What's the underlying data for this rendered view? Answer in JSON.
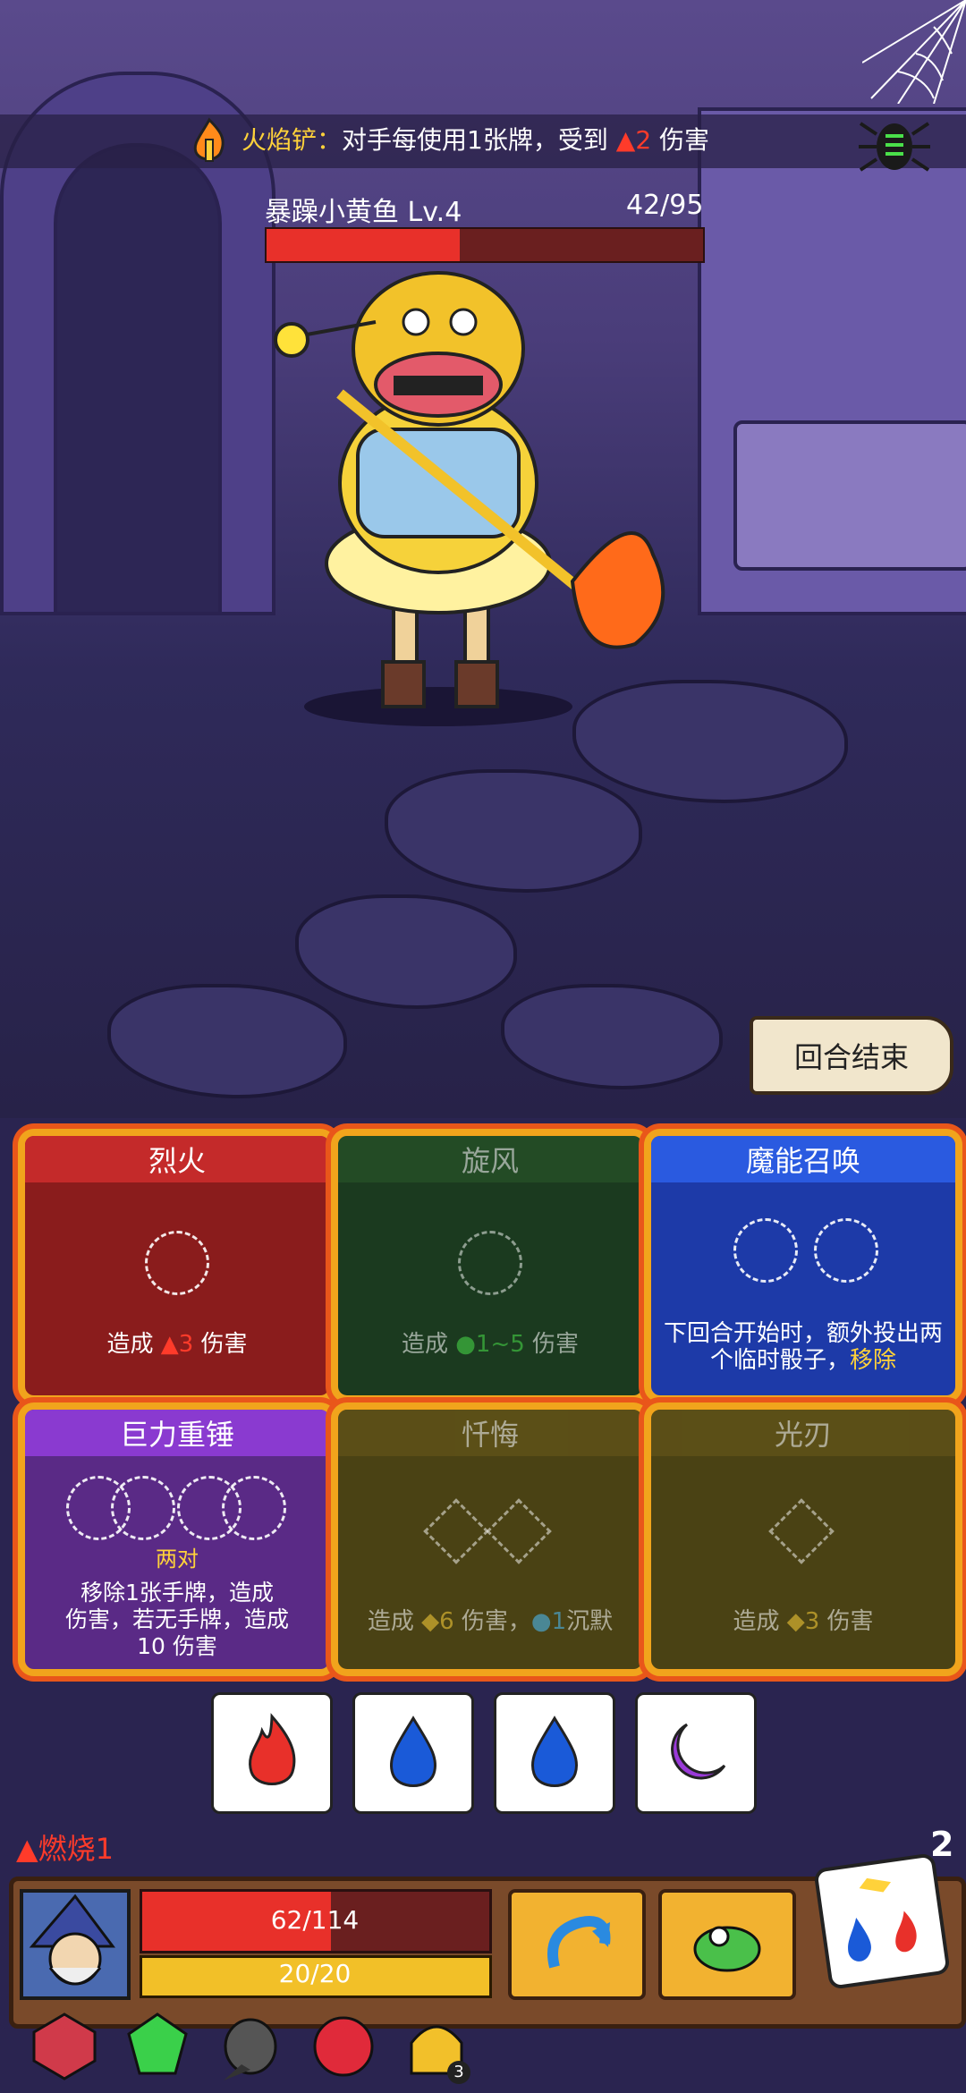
{
  "banner": {
    "item": "火焰铲",
    "colon": "：",
    "text": "对手每使用1张牌，受到",
    "damage": "2",
    "suffix": "伤害"
  },
  "enemy": {
    "name": "暴躁小黄鱼",
    "level": "Lv.4",
    "hp_text": "42/95",
    "hp_fraction": 0.442
  },
  "end_turn_label": "回合结束",
  "cards": [
    {
      "title": "烈火",
      "desc_pre": "造成",
      "value": "3",
      "desc_post": "伤害",
      "color": "#8a1c1c"
    },
    {
      "title": "旋风",
      "desc_pre": "造成",
      "value": "1~5",
      "desc_post": "伤害",
      "color": "#1b3a1f"
    },
    {
      "title": "魔能召唤",
      "desc": "下回合开始时，额外投出两个临时骰子，",
      "action": "移除",
      "color": "#1d3aa8"
    },
    {
      "title": "巨力重锤",
      "sub": "两对",
      "desc": "移除1张手牌，造成",
      "desc2": "伤害，若无手牌，造成",
      "desc3": "10 伤害",
      "color": "#5a2a86"
    },
    {
      "title": "忏悔",
      "desc_pre": "造成",
      "value": "6",
      "desc_post": "伤害，",
      "extra_value": "1",
      "extra": "沉默",
      "color": "#4a4214"
    },
    {
      "title": "光刃",
      "desc_pre": "造成",
      "value": "3",
      "desc_post": "伤害",
      "color": "#4a4214"
    }
  ],
  "dice": [
    {
      "type": "fire-icon",
      "color": "#e8302a"
    },
    {
      "type": "water-icon",
      "color": "#1a5ad8"
    },
    {
      "type": "water-icon",
      "color": "#1a5ad8"
    },
    {
      "type": "moon-icon",
      "color": "#9a3ad8"
    }
  ],
  "status": {
    "burn_label": "燃烧1"
  },
  "dice_count": "2",
  "player": {
    "hp_text": "62/114",
    "hp_fraction": 0.544,
    "shield_text": "20/20",
    "shield_fraction": 1.0
  },
  "relics": [
    "scroll-relic-icon",
    "emerald-relic-icon",
    "plague-mask-relic-icon",
    "ruby-relic-icon",
    "helmet-relic-icon"
  ],
  "relic_count": "3"
}
